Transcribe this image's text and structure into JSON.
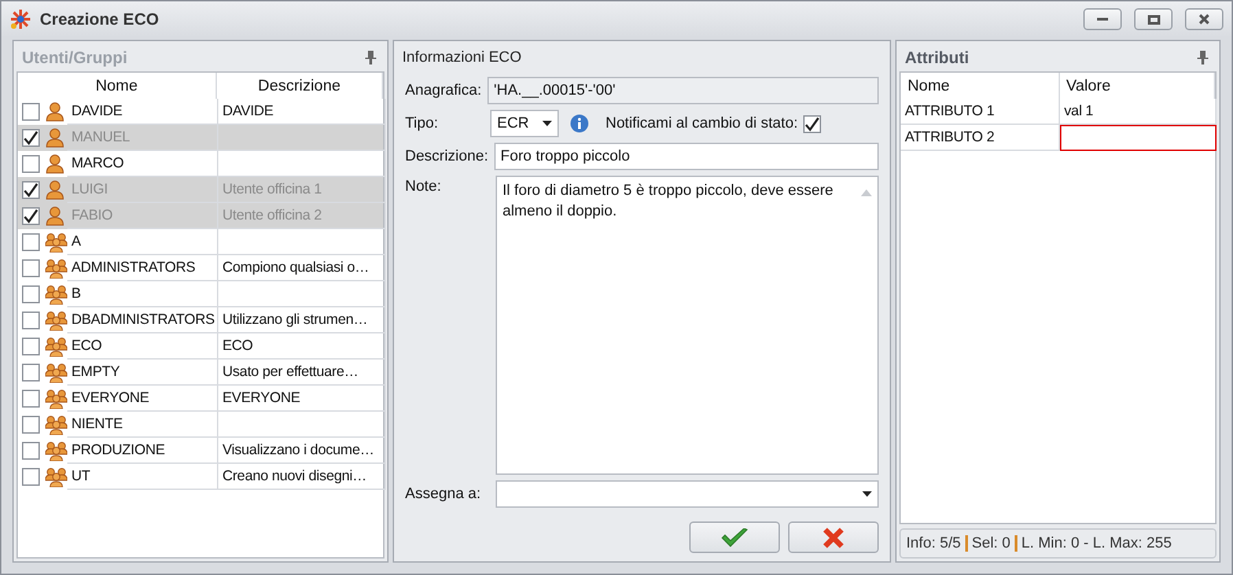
{
  "window": {
    "title": "Creazione ECO"
  },
  "users_panel": {
    "title": "Utenti/Gruppi",
    "columns": [
      "Nome",
      "Descrizione"
    ],
    "rows": [
      {
        "kind": "user",
        "checked": false,
        "name": "DAVIDE",
        "description": "DAVIDE"
      },
      {
        "kind": "user",
        "checked": true,
        "name": "MANUEL",
        "description": ""
      },
      {
        "kind": "user",
        "checked": false,
        "name": "MARCO",
        "description": ""
      },
      {
        "kind": "user",
        "checked": true,
        "name": "LUIGI",
        "description": "Utente officina 1"
      },
      {
        "kind": "user",
        "checked": true,
        "name": "FABIO",
        "description": "Utente officina 2"
      },
      {
        "kind": "group",
        "checked": false,
        "name": "A",
        "description": ""
      },
      {
        "kind": "group",
        "checked": false,
        "name": "ADMINISTRATORS",
        "description": "Compiono qualsiasi o…"
      },
      {
        "kind": "group",
        "checked": false,
        "name": "B",
        "description": ""
      },
      {
        "kind": "group",
        "checked": false,
        "name": "DBADMINISTRATORS",
        "description": "Utilizzano gli strumen…"
      },
      {
        "kind": "group",
        "checked": false,
        "name": "ECO",
        "description": "ECO"
      },
      {
        "kind": "group",
        "checked": false,
        "name": "EMPTY",
        "description": "Usato per effettuare…"
      },
      {
        "kind": "group",
        "checked": false,
        "name": "EVERYONE",
        "description": "EVERYONE"
      },
      {
        "kind": "group",
        "checked": false,
        "name": "NIENTE",
        "description": ""
      },
      {
        "kind": "group",
        "checked": false,
        "name": "PRODUZIONE",
        "description": "Visualizzano i docume…"
      },
      {
        "kind": "group",
        "checked": false,
        "name": "UT",
        "description": "Creano nuovi disegni…"
      }
    ]
  },
  "info_panel": {
    "title": "Informazioni ECO",
    "anagrafica_label": "Anagrafica:",
    "anagrafica": "'HA.__.00015'-'00'",
    "tipo_label": "Tipo:",
    "tipo": "ECR",
    "notify_label": "Notificami al cambio di stato:",
    "notify_checked": true,
    "descrizione_label": "Descrizione:",
    "descrizione": "Foro troppo piccolo",
    "note_label": "Note:",
    "note": "Il foro di diametro 5 è troppo piccolo, deve essere almeno il doppio.",
    "assegna_label": "Assegna a:"
  },
  "attributes_panel": {
    "title": "Attributi",
    "columns": [
      "Nome",
      "Valore"
    ],
    "rows": [
      {
        "name": "ATTRIBUTO 1",
        "value": "val 1",
        "invalid": false
      },
      {
        "name": "ATTRIBUTO 2",
        "value": "",
        "invalid": true
      }
    ],
    "status": [
      "Info: 5/5",
      "Sel: 0",
      "L. Min: 0 - L. Max: 255"
    ]
  }
}
